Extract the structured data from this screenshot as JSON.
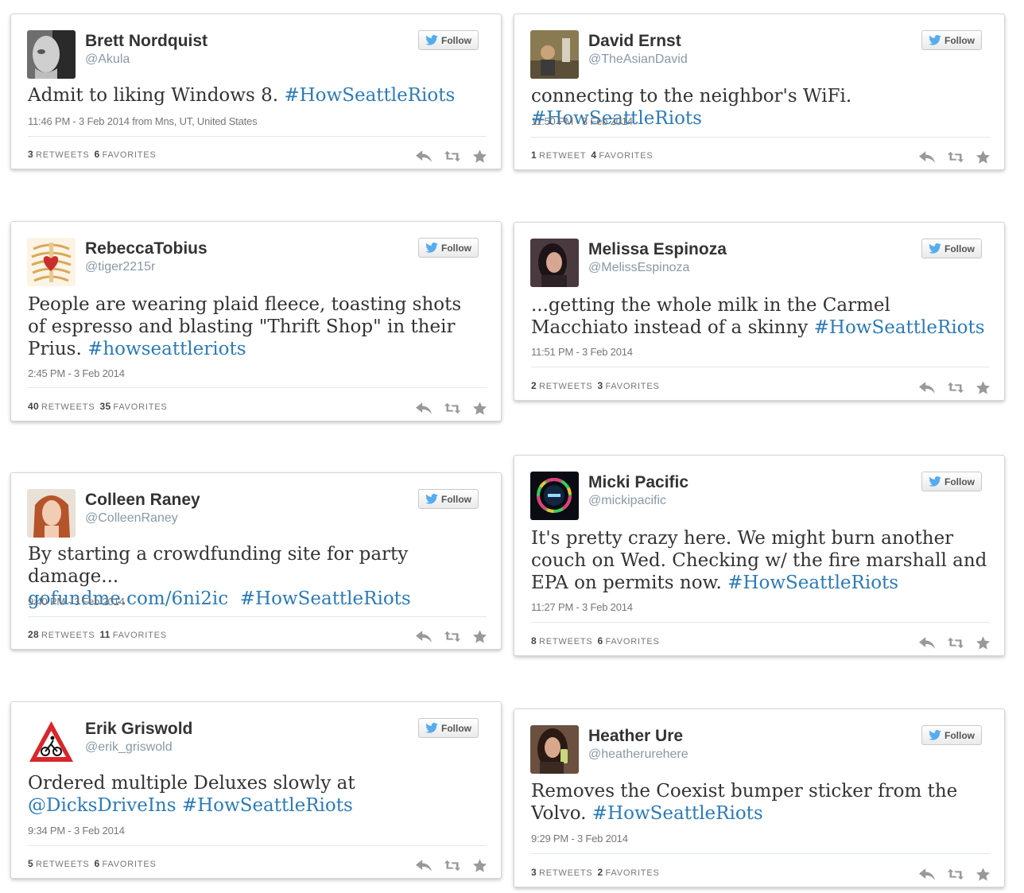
{
  "follow_label": "Follow",
  "colors": {
    "link": "#2b7bb9",
    "twitter_blue": "#55acee",
    "name": "#333333",
    "meta": "#777777"
  },
  "icons": {
    "follow": "twitter-bird-icon",
    "reply": "reply-icon",
    "retweet": "retweet-icon",
    "favorite": "star-icon"
  },
  "tweets": [
    {
      "name": "Brett Nordquist",
      "handle": "@Akula",
      "text_plain": "Admit to liking Windows 8.",
      "text_tag": "#HowSeattleRiots",
      "time": "11:46 PM - 3 Feb 2014 from Mns, UT, United States",
      "retweets": "3",
      "retweets_label": "RETWEETS",
      "favorites": "6",
      "favorites_label": "FAVORITES"
    },
    {
      "name": "David Ernst",
      "handle": "@TheAsianDavid",
      "text_plain": "connecting to the neighbor's WiFi.",
      "text_tag": "#HowSeattleRiots",
      "time": "11:50 PM - 3 Feb 2014",
      "retweets": "1",
      "retweets_label": "RETWEET",
      "favorites": "4",
      "favorites_label": "FAVORITES"
    },
    {
      "name": "RebeccaTobius",
      "handle": "@tiger2215r",
      "text_plain": "People are wearing plaid fleece, toasting shots of espresso and blasting \"Thrift Shop\" in their Prius.",
      "text_tag": "#howseattleriots",
      "time": "2:45 PM - 3 Feb 2014",
      "retweets": "40",
      "retweets_label": "RETWEETS",
      "favorites": "35",
      "favorites_label": "FAVORITES"
    },
    {
      "name": "Melissa Espinoza",
      "handle": "@MelissEspinoza",
      "text_plain": "...getting the whole milk in the Carmel Macchiato instead of a skinny",
      "text_tag": "#HowSeattleRiots",
      "time": "11:51 PM - 3 Feb 2014",
      "retweets": "2",
      "retweets_label": "RETWEETS",
      "favorites": "3",
      "favorites_label": "FAVORITES"
    },
    {
      "name": "Colleen Raney",
      "handle": "@ColleenRaney",
      "text_plain": "By starting a crowdfunding site for party damage...",
      "text_link": "gofundme.com/6ni2ic",
      "text_tag": "#HowSeattleRiots",
      "time": "9:40 PM - 3 Feb 2014",
      "retweets": "28",
      "retweets_label": "RETWEETS",
      "favorites": "11",
      "favorites_label": "FAVORITES"
    },
    {
      "name": "Micki Pacific",
      "handle": "@mickipacific",
      "text_plain": "It's pretty crazy here. We might burn another couch on Wed. Checking w/ the fire marshall and EPA on permits now.",
      "text_tag": "#HowSeattleRiots",
      "time": "11:27 PM - 3 Feb 2014",
      "retweets": "8",
      "retweets_label": "RETWEETS",
      "favorites": "6",
      "favorites_label": "FAVORITES"
    },
    {
      "name": "Erik Griswold",
      "handle": "@erik_griswold",
      "text_plain": "Ordered multiple Deluxes slowly at",
      "text_mention": "@DicksDriveIns",
      "text_tag": "#HowSeattleRiots",
      "time": "9:34 PM - 3 Feb 2014",
      "retweets": "5",
      "retweets_label": "RETWEETS",
      "favorites": "6",
      "favorites_label": "FAVORITES"
    },
    {
      "name": "Heather Ure",
      "handle": "@heatherurehere",
      "text_plain": "Removes the Coexist bumper sticker from the Volvo.",
      "text_tag": "#HowSeattleRiots",
      "time": "9:29 PM - 3 Feb 2014",
      "retweets": "3",
      "retweets_label": "RETWEETS",
      "favorites": "2",
      "favorites_label": "FAVORITES"
    }
  ]
}
